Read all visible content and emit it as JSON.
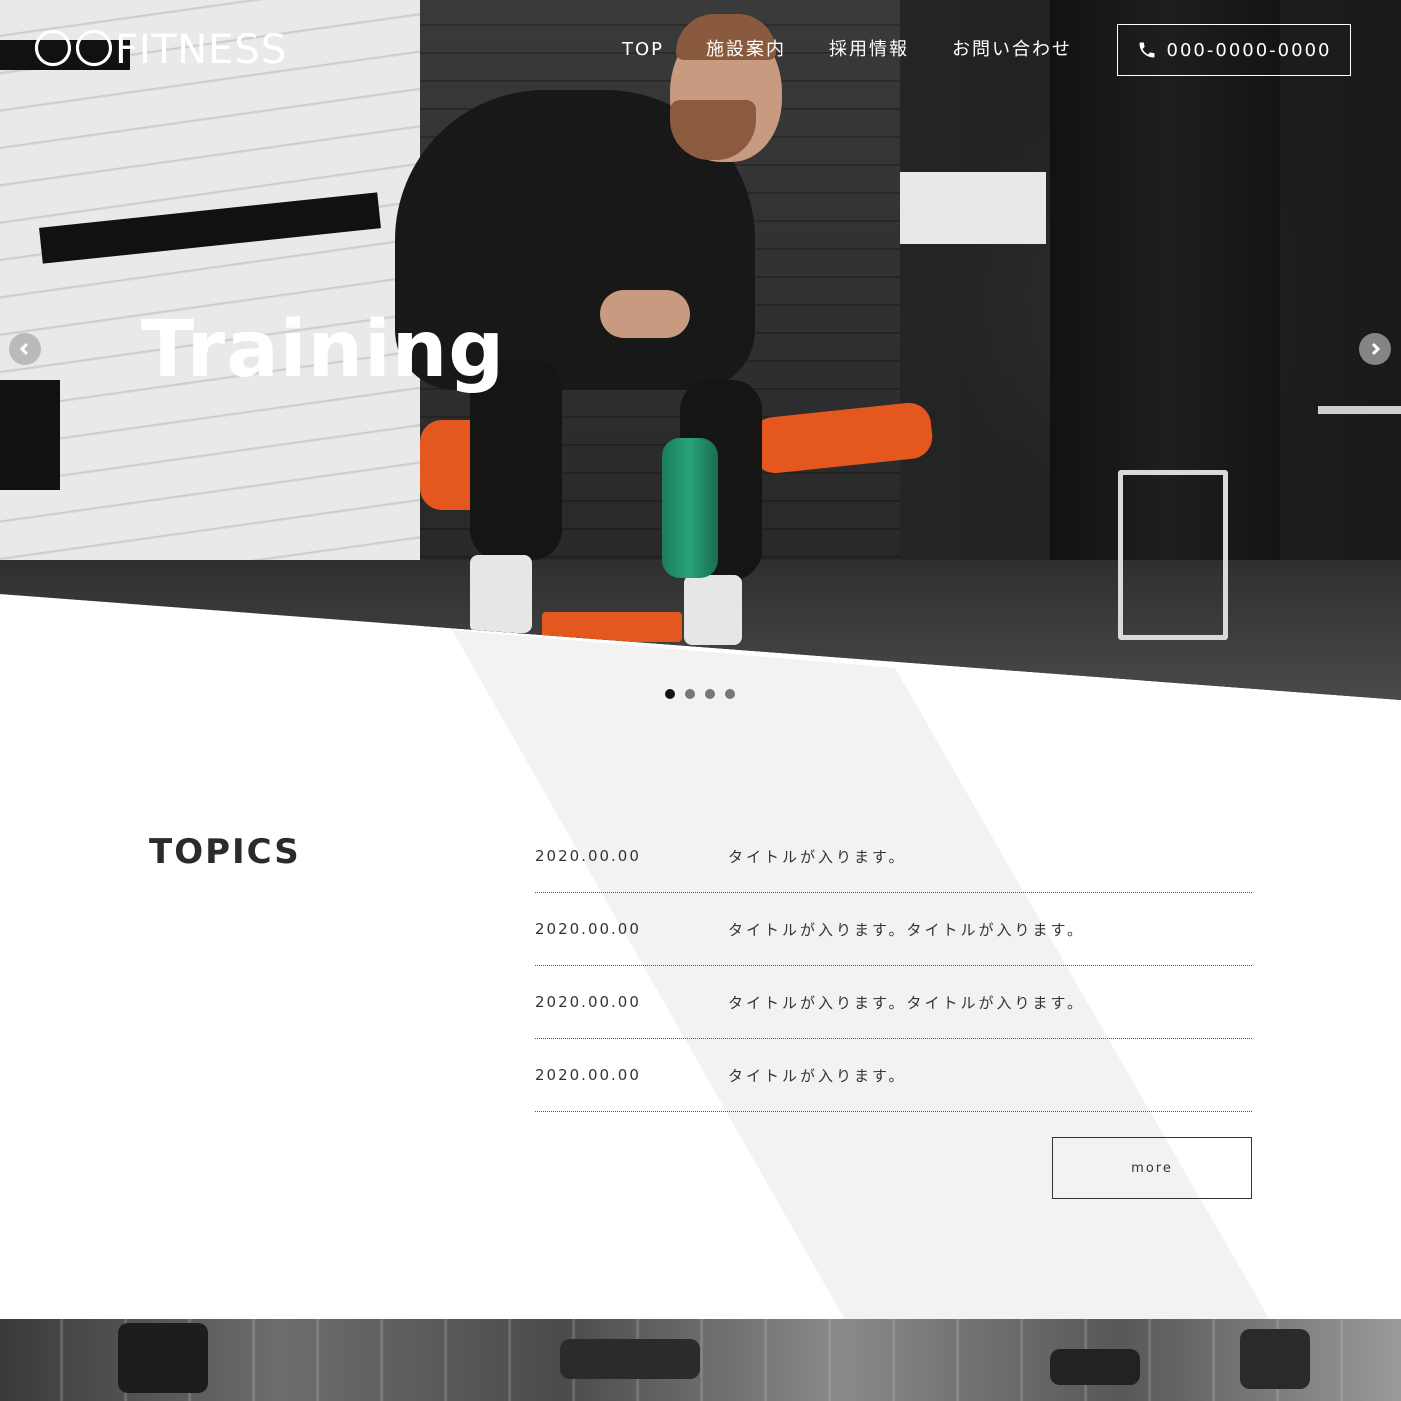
{
  "header": {
    "logo": "〇〇FITNESS",
    "nav": [
      {
        "label": "TOP"
      },
      {
        "label": "施設案内"
      },
      {
        "label": "採用情報"
      },
      {
        "label": "お問い合わせ"
      }
    ],
    "phone": "000-0000-0000"
  },
  "hero": {
    "title": "Training",
    "slide_count": 4,
    "active_slide": 1
  },
  "topics": {
    "heading": "TOPICS",
    "items": [
      {
        "date": "2020.00.00",
        "title": "タイトルが入ります。"
      },
      {
        "date": "2020.00.00",
        "title": "タイトルが入ります。タイトルが入ります。"
      },
      {
        "date": "2020.00.00",
        "title": "タイトルが入ります。タイトルが入ります。"
      },
      {
        "date": "2020.00.00",
        "title": "タイトルが入ります。"
      }
    ],
    "more_label": "more"
  },
  "icons": {
    "phone": "phone-icon",
    "prev": "chevron-left-icon",
    "next": "chevron-right-icon"
  },
  "colors": {
    "text": "#2b2b2b",
    "band": "#f2f2f2",
    "accent_orange": "#e4571f",
    "dot_active": "#111111",
    "dot_inactive": "#777777"
  }
}
